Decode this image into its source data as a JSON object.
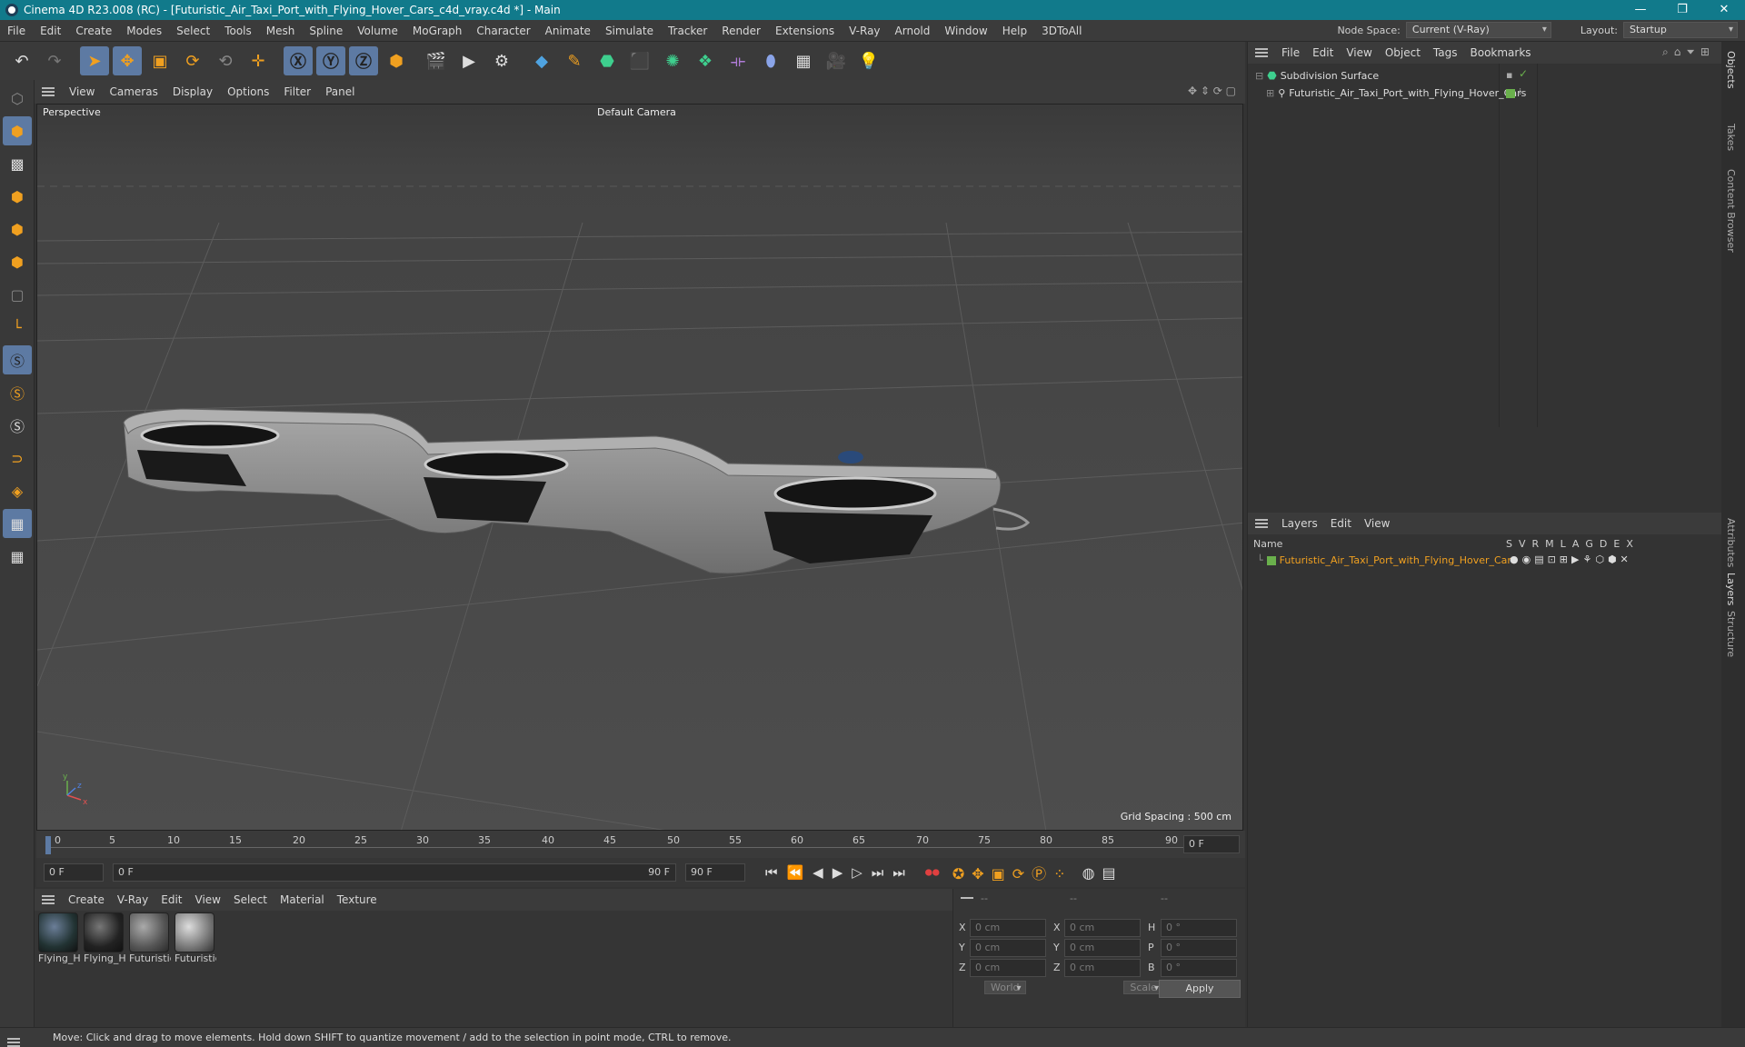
{
  "window": {
    "title": "Cinema 4D R23.008 (RC) - [Futuristic_Air_Taxi_Port_with_Flying_Hover_Cars_c4d_vray.c4d *] - Main"
  },
  "menu": [
    "File",
    "Edit",
    "Create",
    "Modes",
    "Select",
    "Tools",
    "Mesh",
    "Spline",
    "Volume",
    "MoGraph",
    "Character",
    "Animate",
    "Simulate",
    "Tracker",
    "Render",
    "Extensions",
    "V-Ray",
    "Arnold",
    "Window",
    "Help",
    "3DToAll"
  ],
  "nodespace": {
    "label": "Node Space:",
    "value": "Current (V-Ray)"
  },
  "layout": {
    "label": "Layout:",
    "value": "Startup"
  },
  "viewport_menu": [
    "View",
    "Cameras",
    "Display",
    "Options",
    "Filter",
    "Panel"
  ],
  "viewport": {
    "label": "Perspective",
    "camera": "Default Camera",
    "grid_spacing": "Grid Spacing : 500 cm"
  },
  "timeline": {
    "ticks": [
      "0",
      "5",
      "10",
      "15",
      "20",
      "25",
      "30",
      "35",
      "40",
      "45",
      "50",
      "55",
      "60",
      "65",
      "70",
      "75",
      "80",
      "85",
      "90"
    ],
    "current": "0 F",
    "start": "0 F",
    "range_start": "0 F",
    "range_end": "90 F",
    "end": "90 F"
  },
  "material_menu": [
    "Create",
    "V-Ray",
    "Edit",
    "View",
    "Select",
    "Material",
    "Texture"
  ],
  "materials": [
    "Flying_H",
    "Flying_H",
    "Futuristic",
    "Futuristic"
  ],
  "coords": {
    "headers": [
      "--",
      "--",
      "--"
    ],
    "rows": [
      {
        "a": "X",
        "av": "0 cm",
        "b": "X",
        "bv": "0 cm",
        "c": "H",
        "cv": "0 °"
      },
      {
        "a": "Y",
        "av": "0 cm",
        "b": "Y",
        "bv": "0 cm",
        "c": "P",
        "cv": "0 °"
      },
      {
        "a": "Z",
        "av": "0 cm",
        "b": "Z",
        "bv": "0 cm",
        "c": "B",
        "cv": "0 °"
      }
    ],
    "mode1": "World",
    "mode2": "Scale",
    "apply": "Apply"
  },
  "objects_menu": [
    "File",
    "Edit",
    "View",
    "Object",
    "Tags",
    "Bookmarks"
  ],
  "objects": [
    {
      "name": "Subdivision Surface"
    },
    {
      "name": "Futuristic_Air_Taxi_Port_with_Flying_Hover_Cars"
    }
  ],
  "layers_menu": [
    "Layers",
    "Edit",
    "View"
  ],
  "layers": {
    "col_name": "Name",
    "cols": [
      "S",
      "V",
      "R",
      "M",
      "L",
      "A",
      "G",
      "D",
      "E",
      "X"
    ],
    "rows": [
      {
        "name": "Futuristic_Air_Taxi_Port_with_Flying_Hover_Cars"
      }
    ]
  },
  "side_tabs": [
    "Objects",
    "Takes",
    "Content Browser",
    "Attributes",
    "Layers",
    "Structure"
  ],
  "status": "Move: Click and drag to move elements. Hold down SHIFT to quantize movement / add to the selection in point mode, CTRL to remove."
}
